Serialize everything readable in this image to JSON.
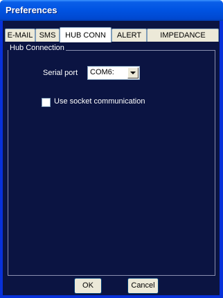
{
  "window": {
    "title": "Preferences"
  },
  "tabs": [
    {
      "label": "E-MAIL",
      "active": false
    },
    {
      "label": "SMS",
      "active": false
    },
    {
      "label": "HUB CONN",
      "active": true
    },
    {
      "label": "ALERT",
      "active": false
    },
    {
      "label": "IMPEDANCE",
      "active": false
    }
  ],
  "hub_connection": {
    "group_label": "Hub Connection",
    "serial_port_label": "Serial port",
    "serial_port_value": "COM6:",
    "socket_label": "Use socket communication",
    "socket_checked": false
  },
  "buttons": {
    "ok": "OK",
    "cancel": "Cancel"
  },
  "colors": {
    "panel_bg": "#0b1442",
    "title_bar": "#0054e3",
    "tab_face": "#ece9d8"
  }
}
